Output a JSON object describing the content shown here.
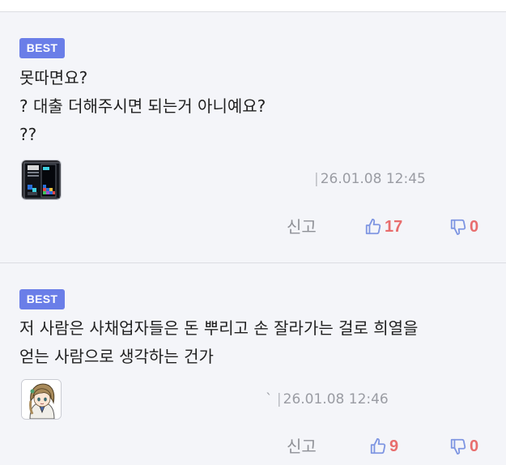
{
  "comments": [
    {
      "badge": "BEST",
      "lines": [
        "못따면요?",
        "? 대출 더해주시면 되는거 아니예요?",
        "??"
      ],
      "nickname": "",
      "date": "26.01.08 12:45",
      "report_label": "신고",
      "upvotes": "17",
      "downvotes": "0",
      "avatar_icon": "tetris-game-avatar"
    },
    {
      "badge": "BEST",
      "lines": [
        "저 사람은 사채업자들은 돈 뿌리고 손 잘라가는 걸로 희열을",
        "얻는 사람으로 생각하는 건가"
      ],
      "nickname": "ˋ",
      "date": "26.01.08 12:46",
      "report_label": "신고",
      "upvotes": "9",
      "downvotes": "0",
      "avatar_icon": "anime-girl-avatar"
    }
  ],
  "colors": {
    "badge_bg": "#6a7ee8",
    "vote_count": "#e86d6d",
    "thumb_icon": "#7f96e2",
    "background": "#f4f5f9"
  }
}
